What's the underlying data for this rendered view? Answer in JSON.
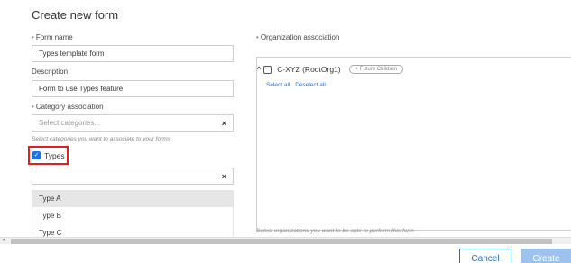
{
  "page": {
    "title": "Create new form"
  },
  "form_name": {
    "label": "Form name",
    "value": "Types template form"
  },
  "description": {
    "label": "Description",
    "value": "Form to use Types feature"
  },
  "category": {
    "label": "Category association",
    "placeholder": "Select categories...",
    "hint": "Select categories you want to associate to your forms",
    "selected_label": "Types",
    "options": [
      "Type A",
      "Type B",
      "Type C"
    ]
  },
  "organization": {
    "label": "Organization association",
    "tree_node": "C-XYZ (RootOrg1)",
    "future_children": "+ Future Children",
    "select_all": "Select all",
    "deselect_all": "Deselect all",
    "hint": "Select organizations you want to be able to perform this form"
  },
  "buttons": {
    "cancel": "Cancel",
    "create": "Create"
  },
  "colors": {
    "accent": "#1b6ed6",
    "highlight_border": "#e02020",
    "create_disabled": "#9ec2ee"
  }
}
